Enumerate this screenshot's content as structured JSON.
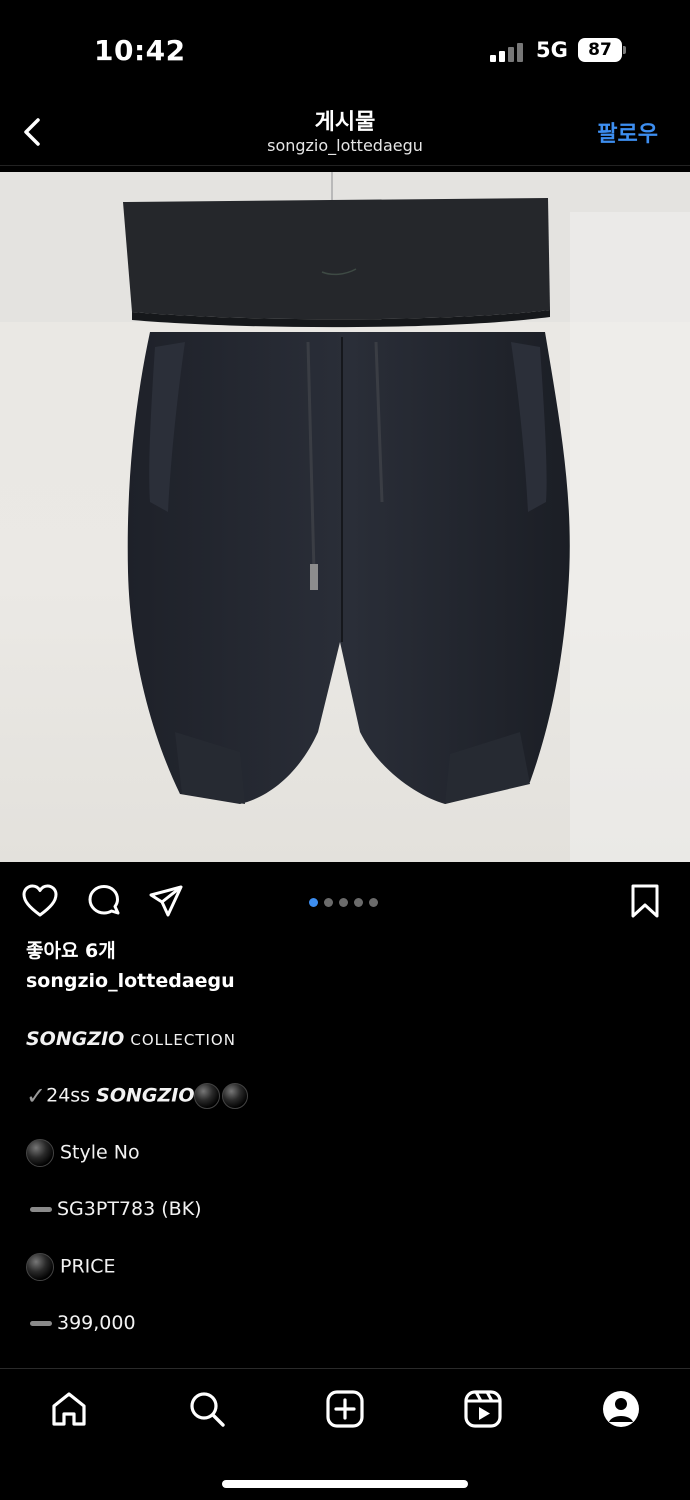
{
  "status_bar": {
    "time": "10:42",
    "network": "5G",
    "battery": "87"
  },
  "header": {
    "title": "게시물",
    "username": "songzio_lottedaegu",
    "follow_label": "팔로우"
  },
  "post": {
    "carousel": {
      "count": 5,
      "active_index": 0
    },
    "likes": "좋아요 6개",
    "author": "songzio_lottedaegu",
    "caption": {
      "brand": "SONGZIO",
      "collection": "COLLECTION",
      "season_prefix": "24ss",
      "season_brand": "SONGZIO",
      "style_label": "Style No",
      "style_value": "SG3PT783 (BK)",
      "price_label": "PRICE",
      "price_value": "399,000"
    }
  },
  "tabbar": [
    "home-icon",
    "search-icon",
    "create-icon",
    "reels-icon",
    "profile-icon"
  ],
  "colors": {
    "accent": "#3d8ef0",
    "background": "#000000"
  }
}
